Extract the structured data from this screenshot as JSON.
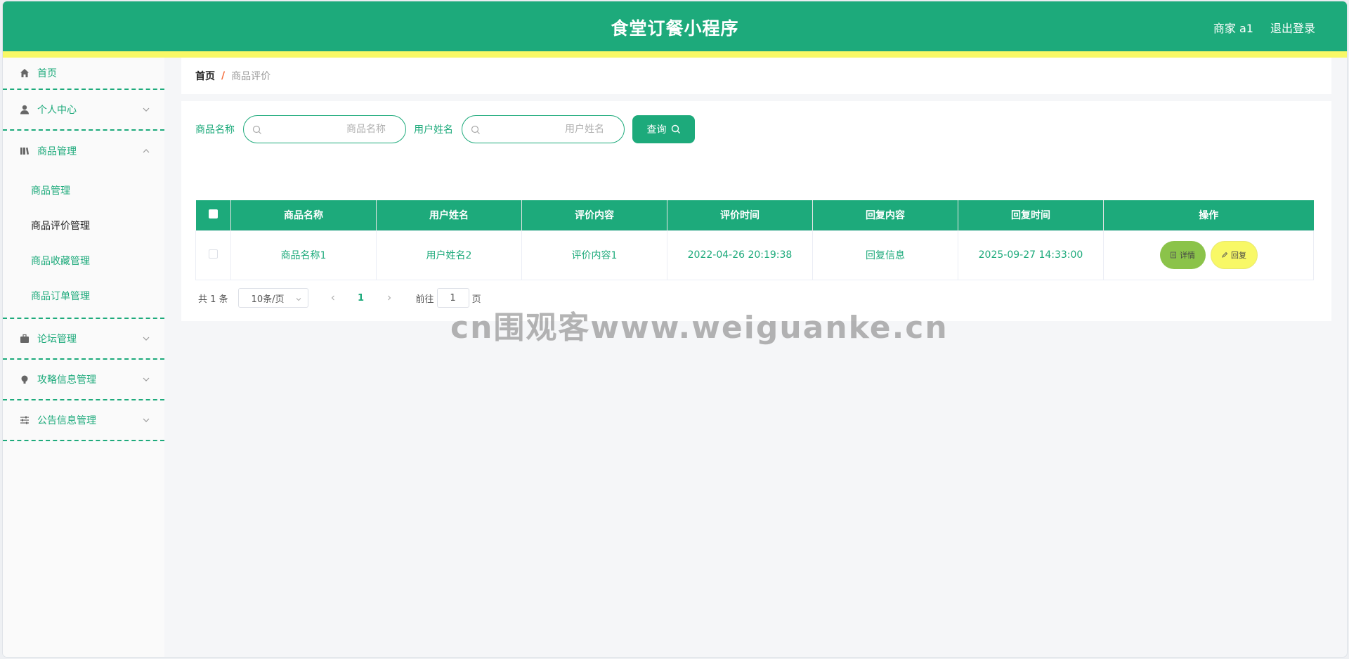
{
  "header": {
    "title": "食堂订餐小程序",
    "user": "商家 a1",
    "logout": "退出登录",
    "bg_color": "#1daa7b",
    "strip_color": "#f8f866"
  },
  "sidebar": {
    "items": [
      {
        "label": "首页",
        "icon": "home-icon"
      },
      {
        "label": "个人中心",
        "icon": "user-icon"
      },
      {
        "label": "商品管理",
        "icon": "book-icon",
        "expanded": true,
        "children": [
          "商品管理",
          "商品评价管理",
          "商品收藏管理",
          "商品订单管理"
        ],
        "active_child": 1
      },
      {
        "label": "论坛管理",
        "icon": "briefcase-icon"
      },
      {
        "label": "攻略信息管理",
        "icon": "bulb-icon"
      },
      {
        "label": "公告信息管理",
        "icon": "sliders-icon"
      }
    ]
  },
  "breadcrumb": {
    "home": "首页",
    "sep": "/",
    "current": "商品评价"
  },
  "search": {
    "field1_label": "商品名称",
    "field1_placeholder": "商品名称",
    "field2_label": "用户姓名",
    "field2_placeholder": "用户姓名",
    "query_label": "查询"
  },
  "table": {
    "headers": [
      "商品名称",
      "用户姓名",
      "评价内容",
      "评价时间",
      "回复内容",
      "回复时间",
      "操作"
    ],
    "rows": [
      {
        "product": "商品名称1",
        "user": "用户姓名2",
        "content": "评价内容1",
        "time": "2022-04-26 20:19:38",
        "reply": "回复信息",
        "reply_time": "2025-09-27 14:33:00"
      }
    ],
    "actions": {
      "detail": "详情",
      "reply": "回复"
    }
  },
  "pagination": {
    "total": "共 1 条",
    "page_size": "10条/页",
    "current_page": "1",
    "goto_label": "前往",
    "goto_value": "1",
    "goto_suffix": "页"
  },
  "watermark": "cn围观客www.weiguanke.cn"
}
